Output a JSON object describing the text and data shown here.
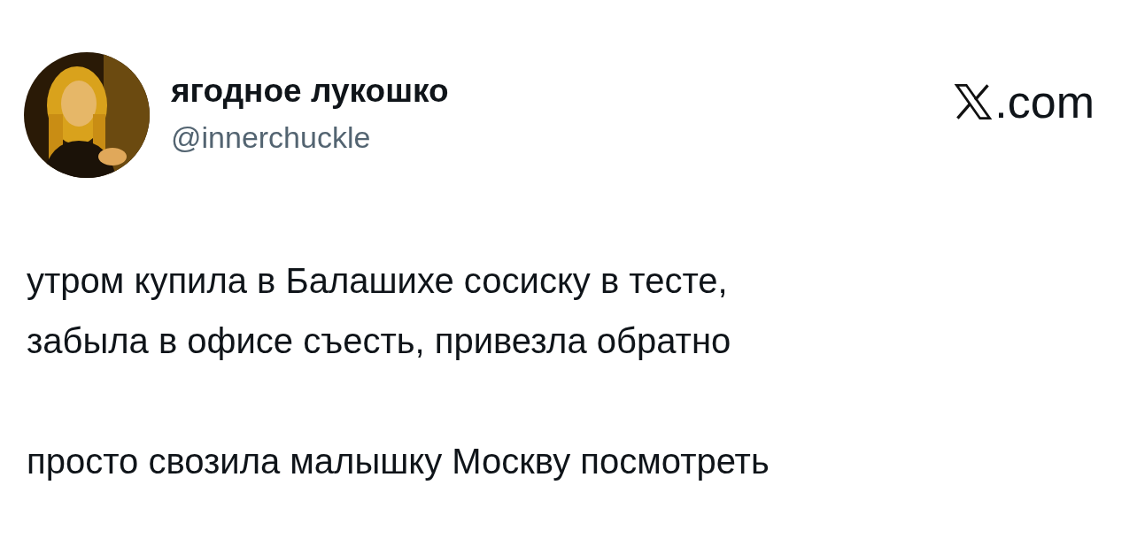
{
  "author": {
    "name": "ягодное лукошко",
    "handle": "@innerchuckle"
  },
  "site": {
    "suffix": ".com"
  },
  "paragraphs": [
    {
      "lines": [
        "утром купила в Балашихе сосиску в тесте,",
        "забыла в офисе съесть, привезла обратно"
      ]
    },
    {
      "lines": [
        "просто свозила малышку Москву посмотреть"
      ]
    }
  ]
}
